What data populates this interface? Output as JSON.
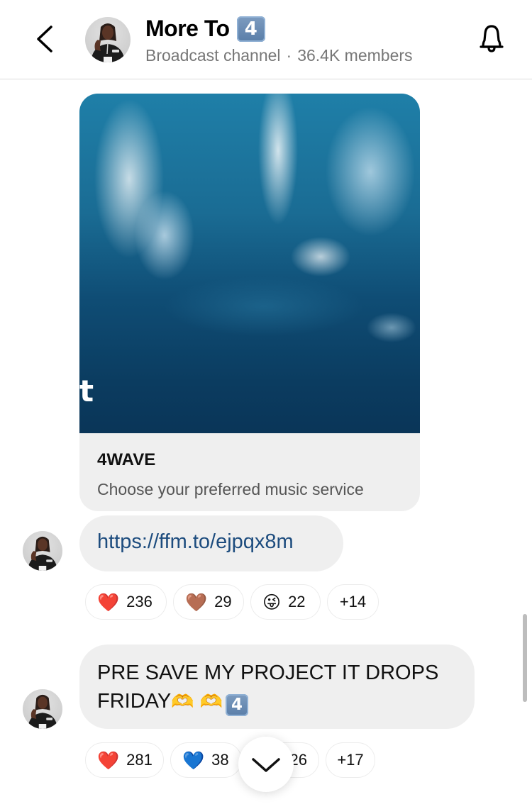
{
  "header": {
    "back_icon": "chevron-left-icon",
    "channel_name": "More To",
    "channel_badge": "4",
    "channel_type": "Broadcast channel",
    "separator": "·",
    "members": "36.4K members",
    "bell_icon": "bell-icon"
  },
  "messages": [
    {
      "type": "link_preview",
      "image_overlay_text": "t",
      "title": "4WAVE",
      "description": "Choose your preferred music service",
      "url": "https://ffm.to/ejpqx8m",
      "reactions": [
        {
          "emoji": "❤️",
          "name": "red-heart",
          "count": "236"
        },
        {
          "emoji": "🤎",
          "name": "brown-heart",
          "count": "29"
        },
        {
          "emoji": "😜",
          "name": "winking-face-with-tongue",
          "count": "22"
        },
        {
          "emoji": "",
          "name": "more",
          "count": "+14"
        }
      ]
    },
    {
      "type": "text",
      "text": "PRE SAVE MY PROJECT IT DROPS FRIDAY",
      "trailing_emojis": [
        "🫶",
        "🫶"
      ],
      "trailing_badge": "4",
      "reactions": [
        {
          "emoji": "❤️",
          "name": "red-heart",
          "count": "281"
        },
        {
          "emoji": "💙",
          "name": "blue-heart",
          "count": "38"
        },
        {
          "emoji": "",
          "name": "hidden",
          "count": "26"
        },
        {
          "emoji": "",
          "name": "more",
          "count": "+17"
        }
      ]
    }
  ],
  "scroll_down_icon": "chevron-down-icon"
}
